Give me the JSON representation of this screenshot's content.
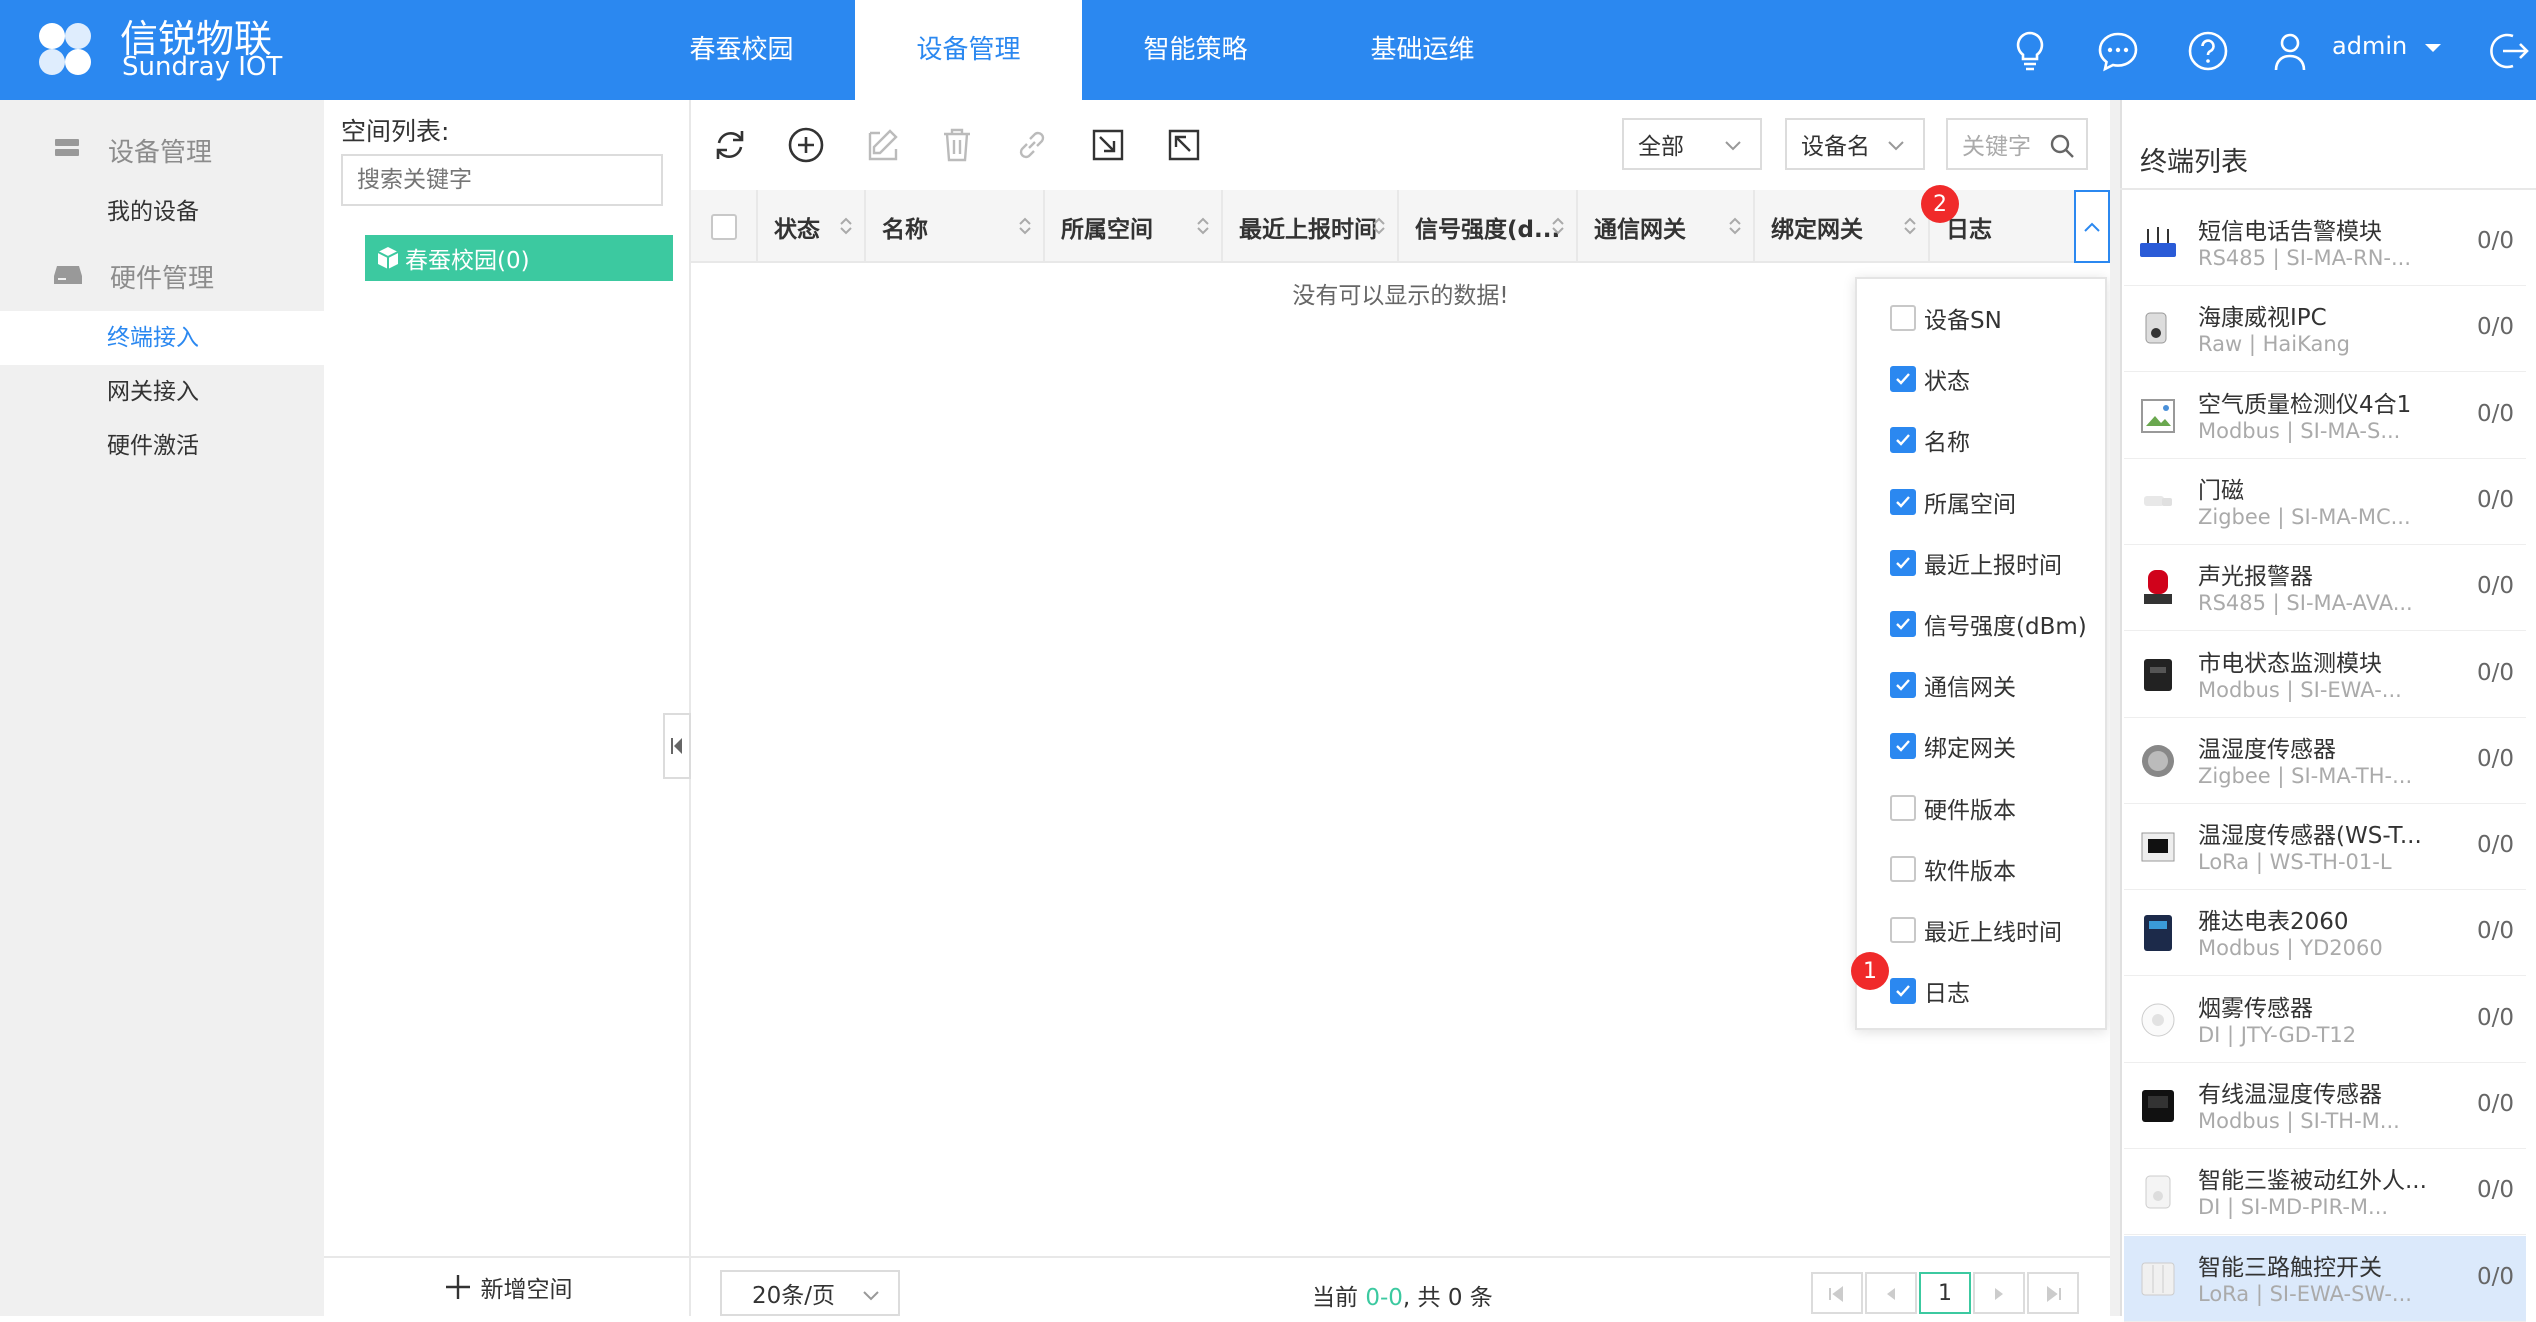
{
  "app": {
    "logo_cn": "信锐物联",
    "logo_en": "Sundray IOT",
    "brand_color": "#2b88f0",
    "accent_green": "#3cc9a0"
  },
  "top_tabs": [
    {
      "label": "春蚕校园"
    },
    {
      "label": "设备管理",
      "active": true
    },
    {
      "label": "智能策略"
    },
    {
      "label": "基础运维"
    }
  ],
  "top_icons": [
    "bulb-icon",
    "chat-icon",
    "help-icon",
    "user-icon",
    "caret-down-icon",
    "logout-icon"
  ],
  "user": {
    "name": "admin"
  },
  "nav": {
    "group1": "设备管理",
    "group1_items": [
      "我的设备"
    ],
    "group2": "硬件管理",
    "group2_items": [
      "终端接入",
      "网关接入",
      "硬件激活"
    ],
    "active": "终端接入"
  },
  "space": {
    "label": "空间列表:",
    "search_placeholder": "搜索关键字",
    "tree_node": "春蚕校园(0)",
    "add_label": "新增空间"
  },
  "toolbar": {
    "icons": [
      "refresh-icon",
      "add-icon",
      "edit-icon",
      "delete-icon",
      "link-icon",
      "import-icon",
      "export-icon"
    ],
    "filter_all": "全部",
    "filter_field": "设备名",
    "keyword_placeholder": "关键字"
  },
  "table": {
    "columns": [
      "状态",
      "名称",
      "所属空间",
      "最近上报时间",
      "信号强度(d...",
      "通信网关",
      "绑定网关",
      "日志"
    ],
    "empty_text": "没有可以显示的数据!"
  },
  "column_menu": {
    "items": [
      {
        "label": "设备SN",
        "checked": false
      },
      {
        "label": "状态",
        "checked": true
      },
      {
        "label": "名称",
        "checked": true
      },
      {
        "label": "所属空间",
        "checked": true
      },
      {
        "label": "最近上报时间",
        "checked": true
      },
      {
        "label": "信号强度(dBm)",
        "checked": true
      },
      {
        "label": "通信网关",
        "checked": true
      },
      {
        "label": "绑定网关",
        "checked": true
      },
      {
        "label": "硬件版本",
        "checked": false
      },
      {
        "label": "软件版本",
        "checked": false
      },
      {
        "label": "最近上线时间",
        "checked": false
      },
      {
        "label": "日志",
        "checked": true
      }
    ]
  },
  "badges": {
    "one": "1",
    "two": "2",
    "color": "#f02a2a"
  },
  "pager": {
    "page_size": "20条/页",
    "summary_prefix": "当前 ",
    "summary_range": "0-0",
    "summary_suffix": ", 共 0 条",
    "current_page": "1"
  },
  "terminals": {
    "title": "终端列表",
    "items": [
      {
        "name": "短信电话告警模块",
        "sub": "RS485 | SI-MA-RN-...",
        "count": "0/0",
        "icon": "router-icon"
      },
      {
        "name": "海康威视IPC",
        "sub": "Raw | HaiKang",
        "count": "0/0",
        "icon": "camera-icon"
      },
      {
        "name": "空气质量检测仪4合1",
        "sub": "Modbus | SI-MA-S...",
        "count": "0/0",
        "icon": "image-placeholder-icon"
      },
      {
        "name": "门磁",
        "sub": "Zigbee | SI-MA-MC...",
        "count": "0/0",
        "icon": "door-sensor-icon"
      },
      {
        "name": "声光报警器",
        "sub": "RS485 | SI-MA-AVA...",
        "count": "0/0",
        "icon": "siren-icon"
      },
      {
        "name": "市电状态监测模块",
        "sub": "Modbus | SI-EWA-...",
        "count": "0/0",
        "icon": "power-module-icon"
      },
      {
        "name": "温湿度传感器",
        "sub": "Zigbee | SI-MA-TH-...",
        "count": "0/0",
        "icon": "thermo-icon"
      },
      {
        "name": "温湿度传感器(WS-T...",
        "sub": "LoRa | WS-TH-01-L",
        "count": "0/0",
        "icon": "display-sensor-icon"
      },
      {
        "name": "雅达电表2060",
        "sub": "Modbus | YD2060",
        "count": "0/0",
        "icon": "meter-icon"
      },
      {
        "name": "烟雾传感器",
        "sub": "DI | JTY-GD-T12",
        "count": "0/0",
        "icon": "smoke-icon"
      },
      {
        "name": "有线温湿度传感器",
        "sub": "Modbus | SI-TH-M...",
        "count": "0/0",
        "icon": "wired-thermo-icon"
      },
      {
        "name": "智能三鉴被动红外人...",
        "sub": "DI | SI-MD-PIR-M...",
        "count": "0/0",
        "icon": "pir-icon"
      },
      {
        "name": "智能三路触控开关",
        "sub": "LoRa | SI-EWA-SW-...",
        "count": "0/0",
        "icon": "switch-icon",
        "selected": true
      }
    ]
  }
}
